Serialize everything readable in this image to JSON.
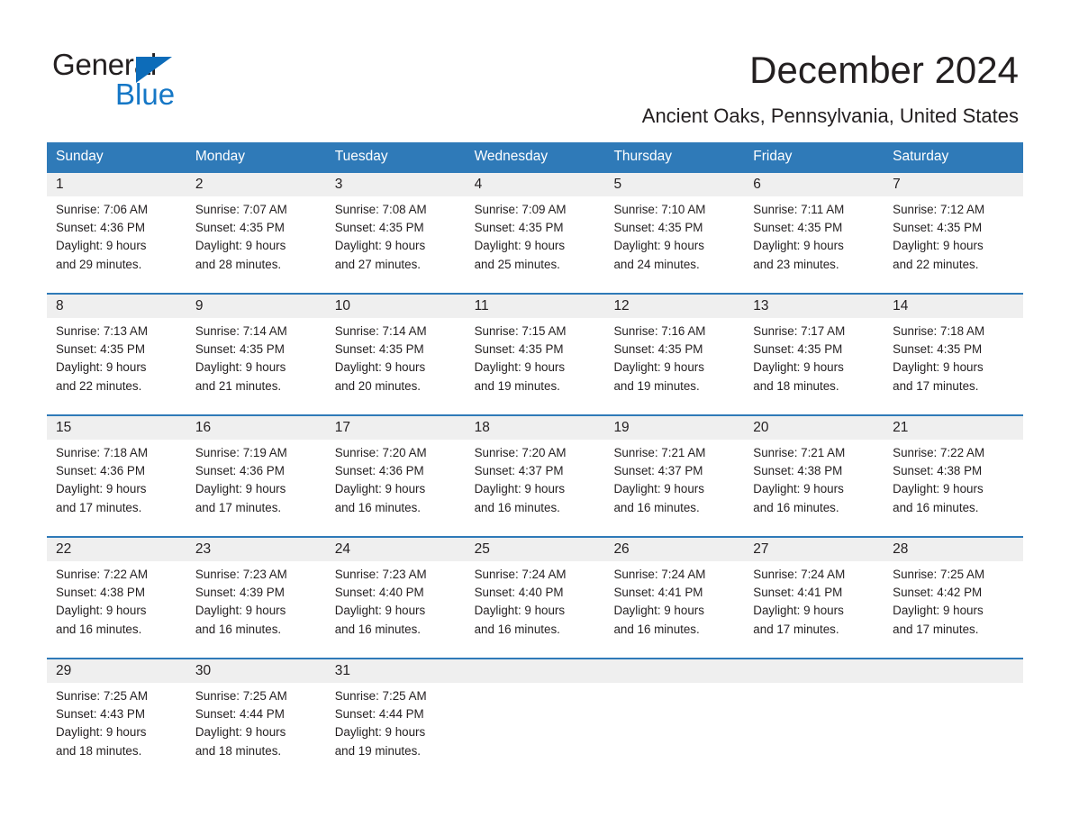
{
  "brand": {
    "name_part1": "General",
    "name_part2": "Blue",
    "triangle_color": "#0d6cb9",
    "blue_color": "#1577c6"
  },
  "header": {
    "title": "December 2024",
    "subtitle": "Ancient Oaks, Pennsylvania, United States"
  },
  "theme": {
    "header_blue": "#2f7ab8",
    "daynum_band": "#efefef",
    "text": "#231f20"
  },
  "calendar": {
    "weekdays": [
      "Sunday",
      "Monday",
      "Tuesday",
      "Wednesday",
      "Thursday",
      "Friday",
      "Saturday"
    ],
    "weeks": [
      [
        {
          "day": "1",
          "sunrise": "Sunrise: 7:06 AM",
          "sunset": "Sunset: 4:36 PM",
          "daylight_1": "Daylight: 9 hours",
          "daylight_2": "and 29 minutes."
        },
        {
          "day": "2",
          "sunrise": "Sunrise: 7:07 AM",
          "sunset": "Sunset: 4:35 PM",
          "daylight_1": "Daylight: 9 hours",
          "daylight_2": "and 28 minutes."
        },
        {
          "day": "3",
          "sunrise": "Sunrise: 7:08 AM",
          "sunset": "Sunset: 4:35 PM",
          "daylight_1": "Daylight: 9 hours",
          "daylight_2": "and 27 minutes."
        },
        {
          "day": "4",
          "sunrise": "Sunrise: 7:09 AM",
          "sunset": "Sunset: 4:35 PM",
          "daylight_1": "Daylight: 9 hours",
          "daylight_2": "and 25 minutes."
        },
        {
          "day": "5",
          "sunrise": "Sunrise: 7:10 AM",
          "sunset": "Sunset: 4:35 PM",
          "daylight_1": "Daylight: 9 hours",
          "daylight_2": "and 24 minutes."
        },
        {
          "day": "6",
          "sunrise": "Sunrise: 7:11 AM",
          "sunset": "Sunset: 4:35 PM",
          "daylight_1": "Daylight: 9 hours",
          "daylight_2": "and 23 minutes."
        },
        {
          "day": "7",
          "sunrise": "Sunrise: 7:12 AM",
          "sunset": "Sunset: 4:35 PM",
          "daylight_1": "Daylight: 9 hours",
          "daylight_2": "and 22 minutes."
        }
      ],
      [
        {
          "day": "8",
          "sunrise": "Sunrise: 7:13 AM",
          "sunset": "Sunset: 4:35 PM",
          "daylight_1": "Daylight: 9 hours",
          "daylight_2": "and 22 minutes."
        },
        {
          "day": "9",
          "sunrise": "Sunrise: 7:14 AM",
          "sunset": "Sunset: 4:35 PM",
          "daylight_1": "Daylight: 9 hours",
          "daylight_2": "and 21 minutes."
        },
        {
          "day": "10",
          "sunrise": "Sunrise: 7:14 AM",
          "sunset": "Sunset: 4:35 PM",
          "daylight_1": "Daylight: 9 hours",
          "daylight_2": "and 20 minutes."
        },
        {
          "day": "11",
          "sunrise": "Sunrise: 7:15 AM",
          "sunset": "Sunset: 4:35 PM",
          "daylight_1": "Daylight: 9 hours",
          "daylight_2": "and 19 minutes."
        },
        {
          "day": "12",
          "sunrise": "Sunrise: 7:16 AM",
          "sunset": "Sunset: 4:35 PM",
          "daylight_1": "Daylight: 9 hours",
          "daylight_2": "and 19 minutes."
        },
        {
          "day": "13",
          "sunrise": "Sunrise: 7:17 AM",
          "sunset": "Sunset: 4:35 PM",
          "daylight_1": "Daylight: 9 hours",
          "daylight_2": "and 18 minutes."
        },
        {
          "day": "14",
          "sunrise": "Sunrise: 7:18 AM",
          "sunset": "Sunset: 4:35 PM",
          "daylight_1": "Daylight: 9 hours",
          "daylight_2": "and 17 minutes."
        }
      ],
      [
        {
          "day": "15",
          "sunrise": "Sunrise: 7:18 AM",
          "sunset": "Sunset: 4:36 PM",
          "daylight_1": "Daylight: 9 hours",
          "daylight_2": "and 17 minutes."
        },
        {
          "day": "16",
          "sunrise": "Sunrise: 7:19 AM",
          "sunset": "Sunset: 4:36 PM",
          "daylight_1": "Daylight: 9 hours",
          "daylight_2": "and 17 minutes."
        },
        {
          "day": "17",
          "sunrise": "Sunrise: 7:20 AM",
          "sunset": "Sunset: 4:36 PM",
          "daylight_1": "Daylight: 9 hours",
          "daylight_2": "and 16 minutes."
        },
        {
          "day": "18",
          "sunrise": "Sunrise: 7:20 AM",
          "sunset": "Sunset: 4:37 PM",
          "daylight_1": "Daylight: 9 hours",
          "daylight_2": "and 16 minutes."
        },
        {
          "day": "19",
          "sunrise": "Sunrise: 7:21 AM",
          "sunset": "Sunset: 4:37 PM",
          "daylight_1": "Daylight: 9 hours",
          "daylight_2": "and 16 minutes."
        },
        {
          "day": "20",
          "sunrise": "Sunrise: 7:21 AM",
          "sunset": "Sunset: 4:38 PM",
          "daylight_1": "Daylight: 9 hours",
          "daylight_2": "and 16 minutes."
        },
        {
          "day": "21",
          "sunrise": "Sunrise: 7:22 AM",
          "sunset": "Sunset: 4:38 PM",
          "daylight_1": "Daylight: 9 hours",
          "daylight_2": "and 16 minutes."
        }
      ],
      [
        {
          "day": "22",
          "sunrise": "Sunrise: 7:22 AM",
          "sunset": "Sunset: 4:38 PM",
          "daylight_1": "Daylight: 9 hours",
          "daylight_2": "and 16 minutes."
        },
        {
          "day": "23",
          "sunrise": "Sunrise: 7:23 AM",
          "sunset": "Sunset: 4:39 PM",
          "daylight_1": "Daylight: 9 hours",
          "daylight_2": "and 16 minutes."
        },
        {
          "day": "24",
          "sunrise": "Sunrise: 7:23 AM",
          "sunset": "Sunset: 4:40 PM",
          "daylight_1": "Daylight: 9 hours",
          "daylight_2": "and 16 minutes."
        },
        {
          "day": "25",
          "sunrise": "Sunrise: 7:24 AM",
          "sunset": "Sunset: 4:40 PM",
          "daylight_1": "Daylight: 9 hours",
          "daylight_2": "and 16 minutes."
        },
        {
          "day": "26",
          "sunrise": "Sunrise: 7:24 AM",
          "sunset": "Sunset: 4:41 PM",
          "daylight_1": "Daylight: 9 hours",
          "daylight_2": "and 16 minutes."
        },
        {
          "day": "27",
          "sunrise": "Sunrise: 7:24 AM",
          "sunset": "Sunset: 4:41 PM",
          "daylight_1": "Daylight: 9 hours",
          "daylight_2": "and 17 minutes."
        },
        {
          "day": "28",
          "sunrise": "Sunrise: 7:25 AM",
          "sunset": "Sunset: 4:42 PM",
          "daylight_1": "Daylight: 9 hours",
          "daylight_2": "and 17 minutes."
        }
      ],
      [
        {
          "day": "29",
          "sunrise": "Sunrise: 7:25 AM",
          "sunset": "Sunset: 4:43 PM",
          "daylight_1": "Daylight: 9 hours",
          "daylight_2": "and 18 minutes."
        },
        {
          "day": "30",
          "sunrise": "Sunrise: 7:25 AM",
          "sunset": "Sunset: 4:44 PM",
          "daylight_1": "Daylight: 9 hours",
          "daylight_2": "and 18 minutes."
        },
        {
          "day": "31",
          "sunrise": "Sunrise: 7:25 AM",
          "sunset": "Sunset: 4:44 PM",
          "daylight_1": "Daylight: 9 hours",
          "daylight_2": "and 19 minutes."
        },
        {
          "day": "",
          "sunrise": "",
          "sunset": "",
          "daylight_1": "",
          "daylight_2": ""
        },
        {
          "day": "",
          "sunrise": "",
          "sunset": "",
          "daylight_1": "",
          "daylight_2": ""
        },
        {
          "day": "",
          "sunrise": "",
          "sunset": "",
          "daylight_1": "",
          "daylight_2": ""
        },
        {
          "day": "",
          "sunrise": "",
          "sunset": "",
          "daylight_1": "",
          "daylight_2": ""
        }
      ]
    ]
  }
}
